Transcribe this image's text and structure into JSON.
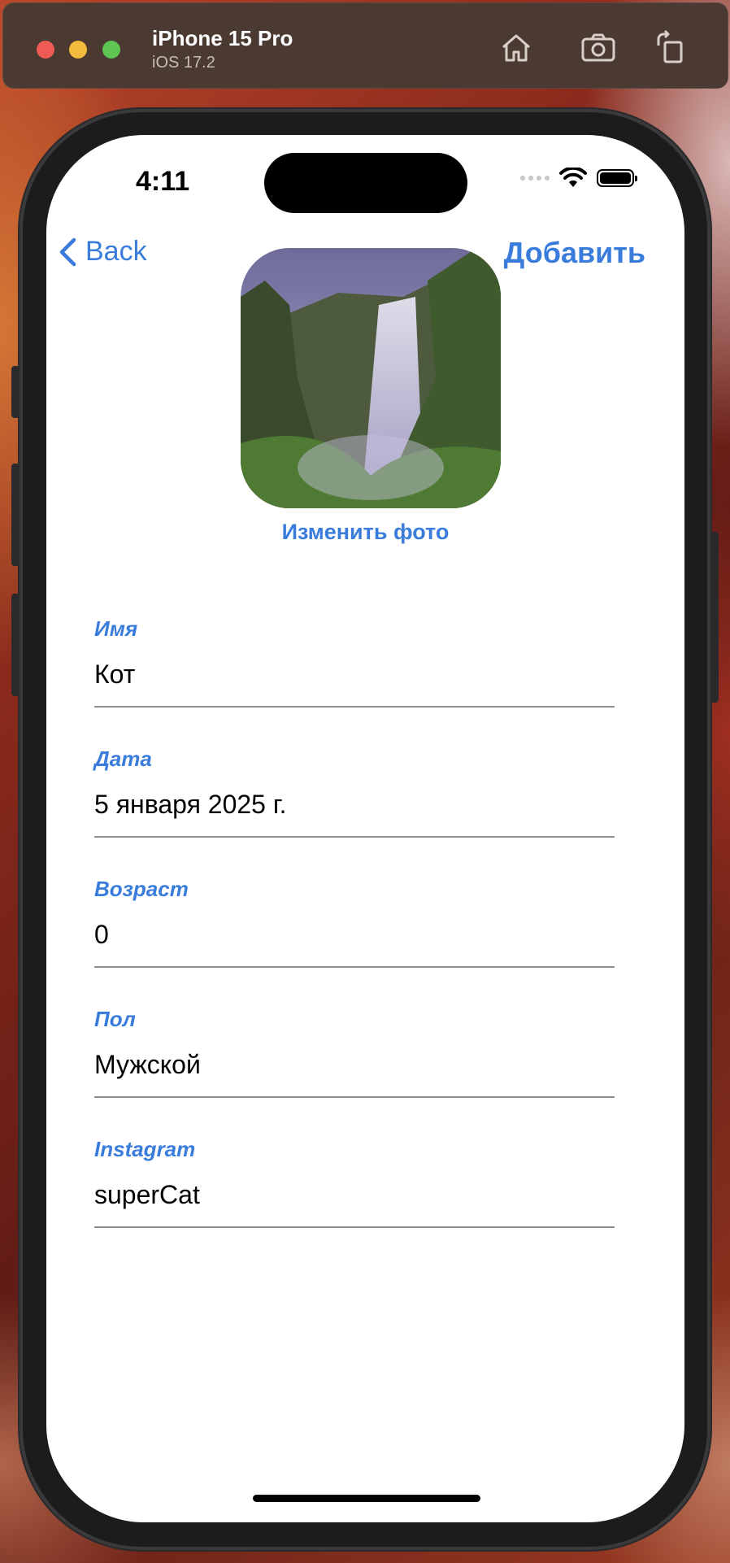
{
  "window": {
    "device_name": "iPhone 15 Pro",
    "os_version": "iOS 17.2",
    "toolbar_icons": [
      "home-icon",
      "screenshot-icon",
      "rotate-icon"
    ]
  },
  "status_bar": {
    "time": "4:11"
  },
  "nav": {
    "back_label": "Back",
    "add_label": "Добавить"
  },
  "photo": {
    "change_label": "Изменить фото"
  },
  "fields": [
    {
      "label": "Имя",
      "value": "Кот"
    },
    {
      "label": "Дата",
      "value": "5 января 2025 г."
    },
    {
      "label": "Возраст",
      "value": "0"
    },
    {
      "label": "Пол",
      "value": "Мужской"
    },
    {
      "label": "Instagram",
      "value": "superCat"
    }
  ],
  "colors": {
    "accent": "#3a7cdb",
    "divider": "#8e8e93"
  }
}
